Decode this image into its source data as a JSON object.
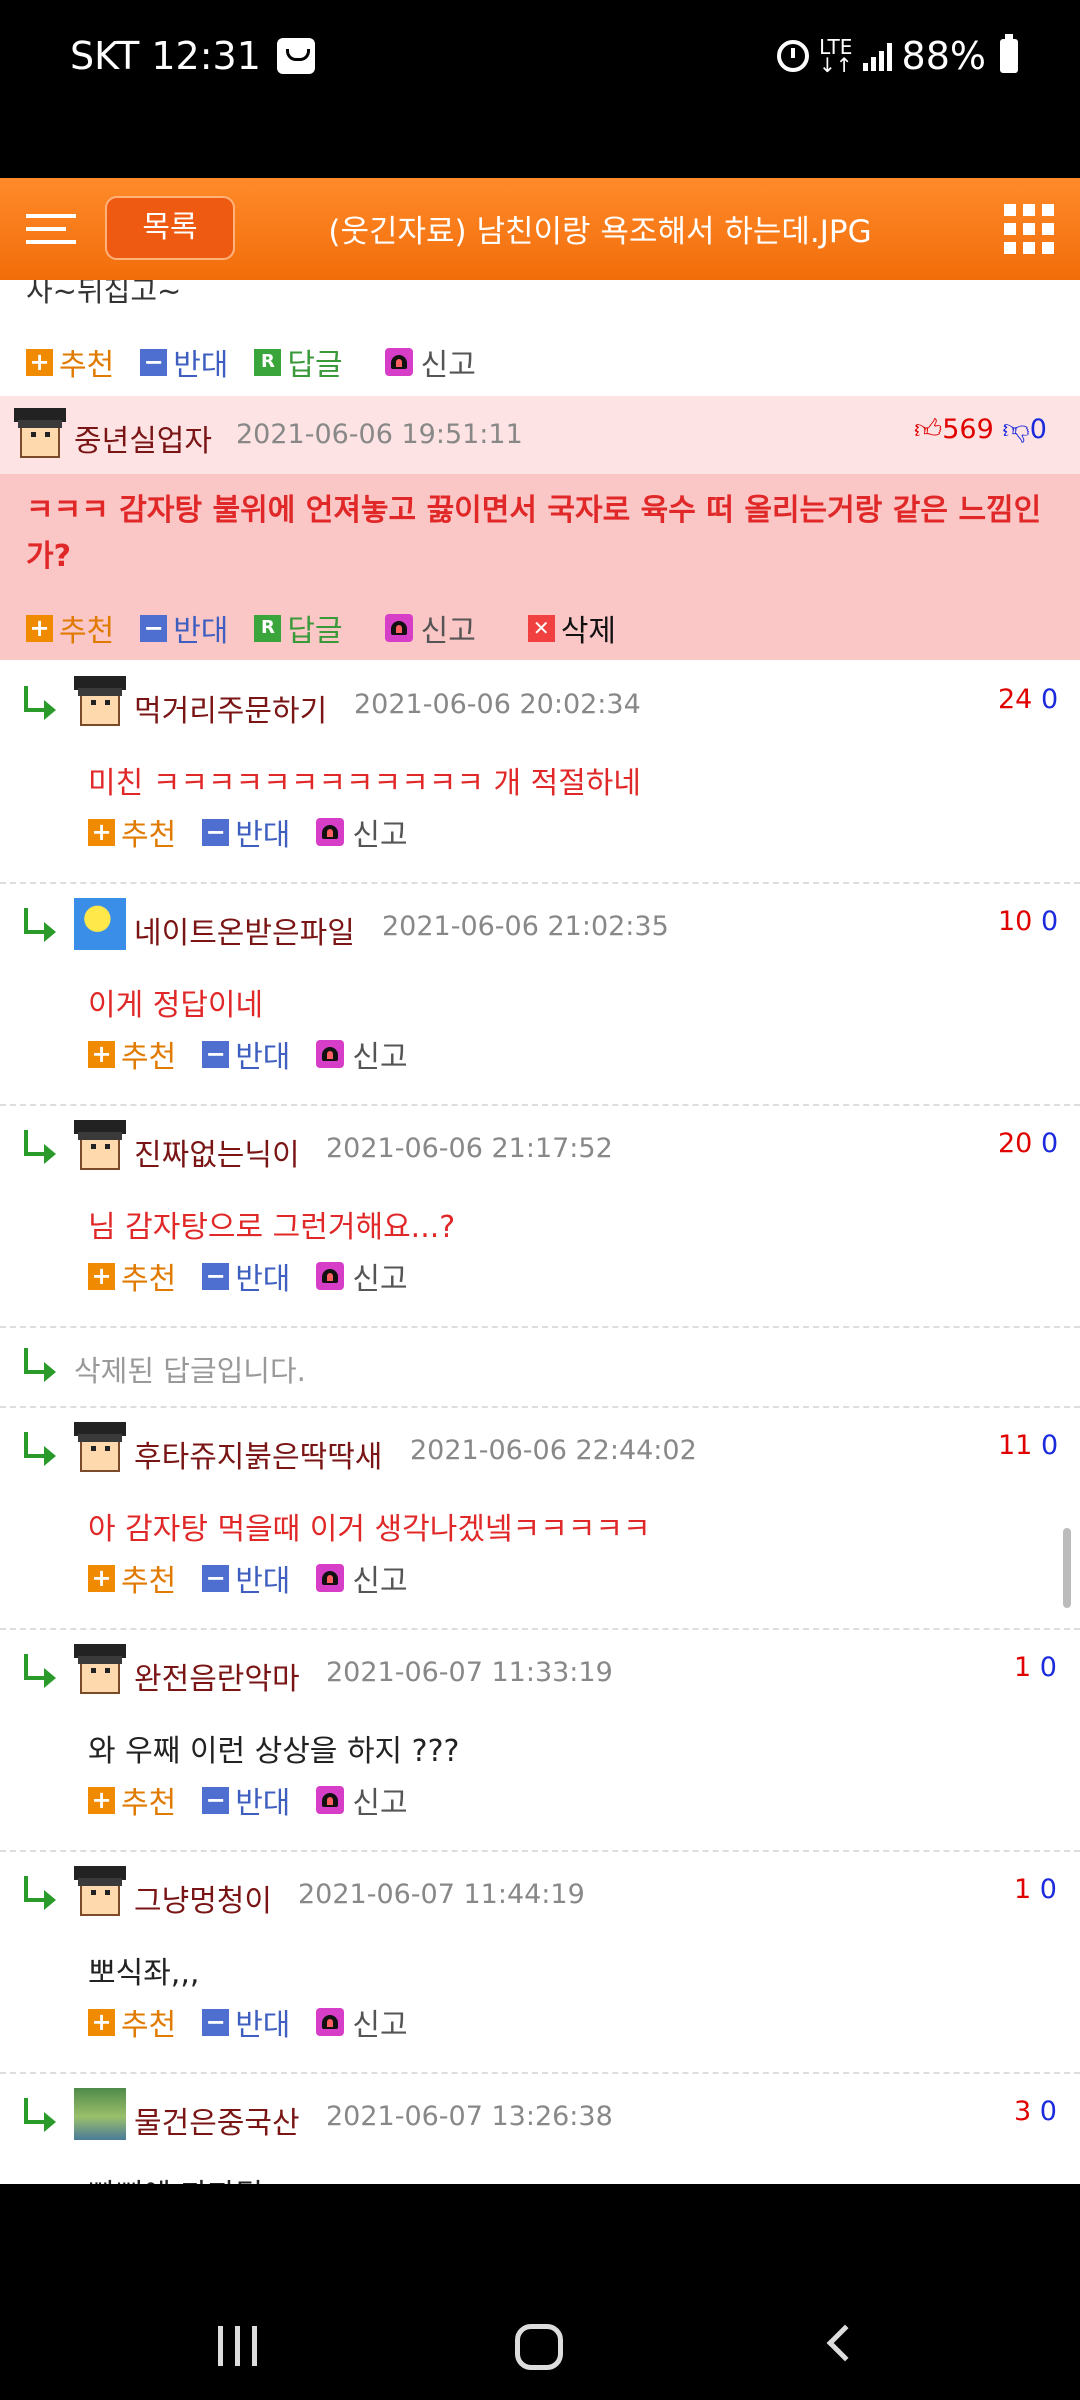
{
  "status": {
    "carrier_time": "SKT 12:31",
    "network": "LTE",
    "battery": "88%"
  },
  "header": {
    "list_label": "목록",
    "title": "(웃긴자료) 남친이랑 욕조해서 하는데.JPG"
  },
  "cut_text": "사~뒤집고~",
  "labels": {
    "up": "추천",
    "down": "반대",
    "reply": "답글",
    "report": "신고",
    "delete": "삭제"
  },
  "best_comment": {
    "nick": "중년실업자",
    "date": "2021-06-06 19:51:11",
    "up": "569",
    "down": "0",
    "text": "ㅋㅋㅋ 감자탕 불위에 언져놓고 끓이면서 국자로 육수 떠 올리는거랑 같은 느낌인가?"
  },
  "replies": [
    {
      "nick": "먹거리주문하기",
      "date": "2021-06-06 20:02:34",
      "up": "24",
      "down": "0",
      "text": "미친 ㅋㅋㅋㅋㅋㅋㅋㅋㅋㅋㅋㅋ 개 적절하네"
    },
    {
      "nick": "네이트온받은파일",
      "date": "2021-06-06 21:02:35",
      "up": "10",
      "down": "0",
      "text": "이게 정답이네"
    },
    {
      "nick": "진짜없는닉이",
      "date": "2021-06-06 21:17:52",
      "up": "20",
      "down": "0",
      "text": "님 감자탕으로 그런거해요...?"
    },
    {
      "nick": "후타쥬지붉은딱딱새",
      "date": "2021-06-06 22:44:02",
      "up": "11",
      "down": "0",
      "text": "아 감자탕 먹을때 이거 생각나겠넼ㅋㅋㅋㅋㅋ"
    },
    {
      "nick": "완전음란악마",
      "date": "2021-06-07 11:33:19",
      "up": "1",
      "down": "0",
      "text": "와 우째 이런 상상을 하지 ???"
    },
    {
      "nick": "그냥멍청이",
      "date": "2021-06-07 11:44:19",
      "up": "1",
      "down": "0",
      "text": "뽀식좌,,,"
    },
    {
      "nick": "물건은중국산",
      "date": "2021-06-07 13:26:38",
      "up": "3",
      "down": "0",
      "text": "빠삐에 과자팀"
    }
  ],
  "deleted_reply": "삭제된 답글입니다."
}
